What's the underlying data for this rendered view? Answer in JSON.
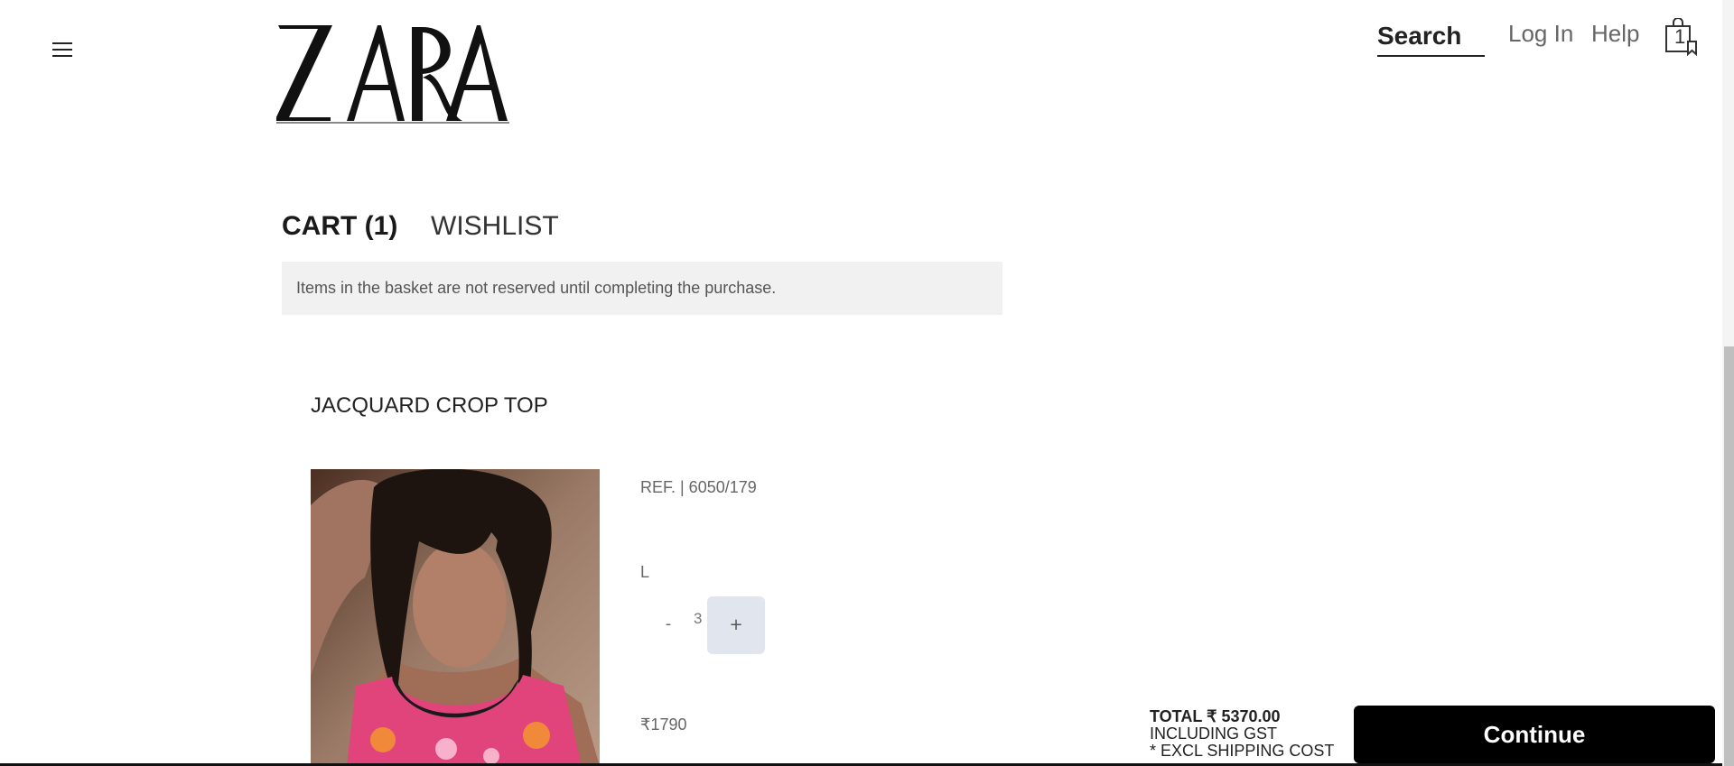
{
  "header": {
    "brand": "ZARA",
    "search_label": "Search",
    "login_label": "Log In",
    "help_label": "Help",
    "bag_count": "1"
  },
  "tabs": {
    "cart_label": "CART (1)",
    "wishlist_label": "WISHLIST"
  },
  "notice": "Items in the basket are not reserved until completing the purchase.",
  "item": {
    "name": "JACQUARD CROP TOP",
    "ref": "REF. | 6050/179",
    "size": "L",
    "qty_minus": "-",
    "quantity": "3",
    "qty_plus": "+",
    "price": "₹1790"
  },
  "summary": {
    "total": "TOTAL ₹ 5370.00",
    "gst_note": "INCLUDING GST",
    "shipping_note": "* EXCL SHIPPING COST",
    "continue_label": "Continue"
  },
  "colors": {
    "button_bg": "#000000",
    "notice_bg": "#f1f1f1",
    "qty_plus_bg": "#e1e6ee"
  }
}
